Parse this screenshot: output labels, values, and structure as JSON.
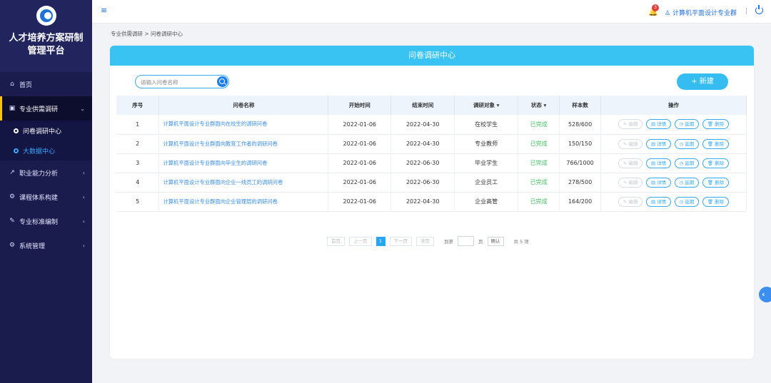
{
  "sidebar": {
    "title_line1": "人才培养方案研制",
    "title_line2": "管理平台",
    "items": [
      {
        "label": "首页",
        "icon": "home-icon",
        "glyph": "⌂"
      },
      {
        "label": "专业供需调研",
        "icon": "survey-icon",
        "glyph": "▣",
        "arrow": "⌄"
      },
      {
        "label": "职业能力分析",
        "icon": "analysis-icon",
        "glyph": "↗",
        "arrow": "‹"
      },
      {
        "label": "课程体系构建",
        "icon": "course-icon",
        "glyph": "⚙",
        "arrow": "‹"
      },
      {
        "label": "专业标准编制",
        "icon": "edit-doc-icon",
        "glyph": "✎",
        "arrow": "‹"
      },
      {
        "label": "系统管理",
        "icon": "settings-icon",
        "glyph": "⚙",
        "arrow": "‹"
      }
    ],
    "sub_items": [
      {
        "label": "问卷调研中心"
      },
      {
        "label": "大数据中心"
      }
    ]
  },
  "topbar": {
    "menu_glyph": "≡",
    "notification_count": "3",
    "bell_glyph": "🔔",
    "user_name": "计算机平面设计专业群",
    "separator": "|"
  },
  "breadcrumb": "专业供需调研 > 问卷调研中心",
  "card": {
    "title": "问卷调研中心",
    "search_placeholder": "请输入问卷名称",
    "new_button": "+ 新建"
  },
  "table": {
    "headers": [
      "序号",
      "问卷名称",
      "开始时间",
      "结束时间",
      "调研对象 ▾",
      "状态 ▾",
      "样本数",
      "操作"
    ],
    "rows": [
      {
        "no": "1",
        "name": "计算机平面设计专业群面向在校生的调研问卷",
        "start": "2022-01-06",
        "end": "2022-04-30",
        "target": "在校学生",
        "status": "已完成",
        "samples": "528/600"
      },
      {
        "no": "2",
        "name": "计算机平面设计专业群面向教育工作者的调研问卷",
        "start": "2022-01-06",
        "end": "2022-04-30",
        "target": "专业教师",
        "status": "已完成",
        "samples": "150/150"
      },
      {
        "no": "3",
        "name": "计算机平面设计专业群面向毕业生的调研问卷",
        "start": "2022-01-06",
        "end": "2022-06-30",
        "target": "毕业学生",
        "status": "已完成",
        "samples": "766/1000"
      },
      {
        "no": "4",
        "name": "计算机平面设计专业群面向企业一线员工的调研问卷",
        "start": "2022-01-06",
        "end": "2022-06-30",
        "target": "企业员工",
        "status": "已完成",
        "samples": "278/500"
      },
      {
        "no": "5",
        "name": "计算机平面设计专业群面向企业管理层的调研问卷",
        "start": "2022-01-06",
        "end": "2022-04-30",
        "target": "企业高管",
        "status": "已完成",
        "samples": "164/200"
      }
    ],
    "actions": {
      "edit": "编辑",
      "detail": "详情",
      "extend": "延期",
      "delete": "删除"
    },
    "colors": {
      "link": "#3a8fe6",
      "status_done": "#43c060"
    }
  },
  "pager": {
    "first": "首页",
    "prev": "上一页",
    "current": "1",
    "next": "下一页",
    "last": "末页",
    "goto_prefix": "到第",
    "goto_suffix": "页",
    "confirm": "确认",
    "total": "共 5 项"
  },
  "float_button": "‹"
}
